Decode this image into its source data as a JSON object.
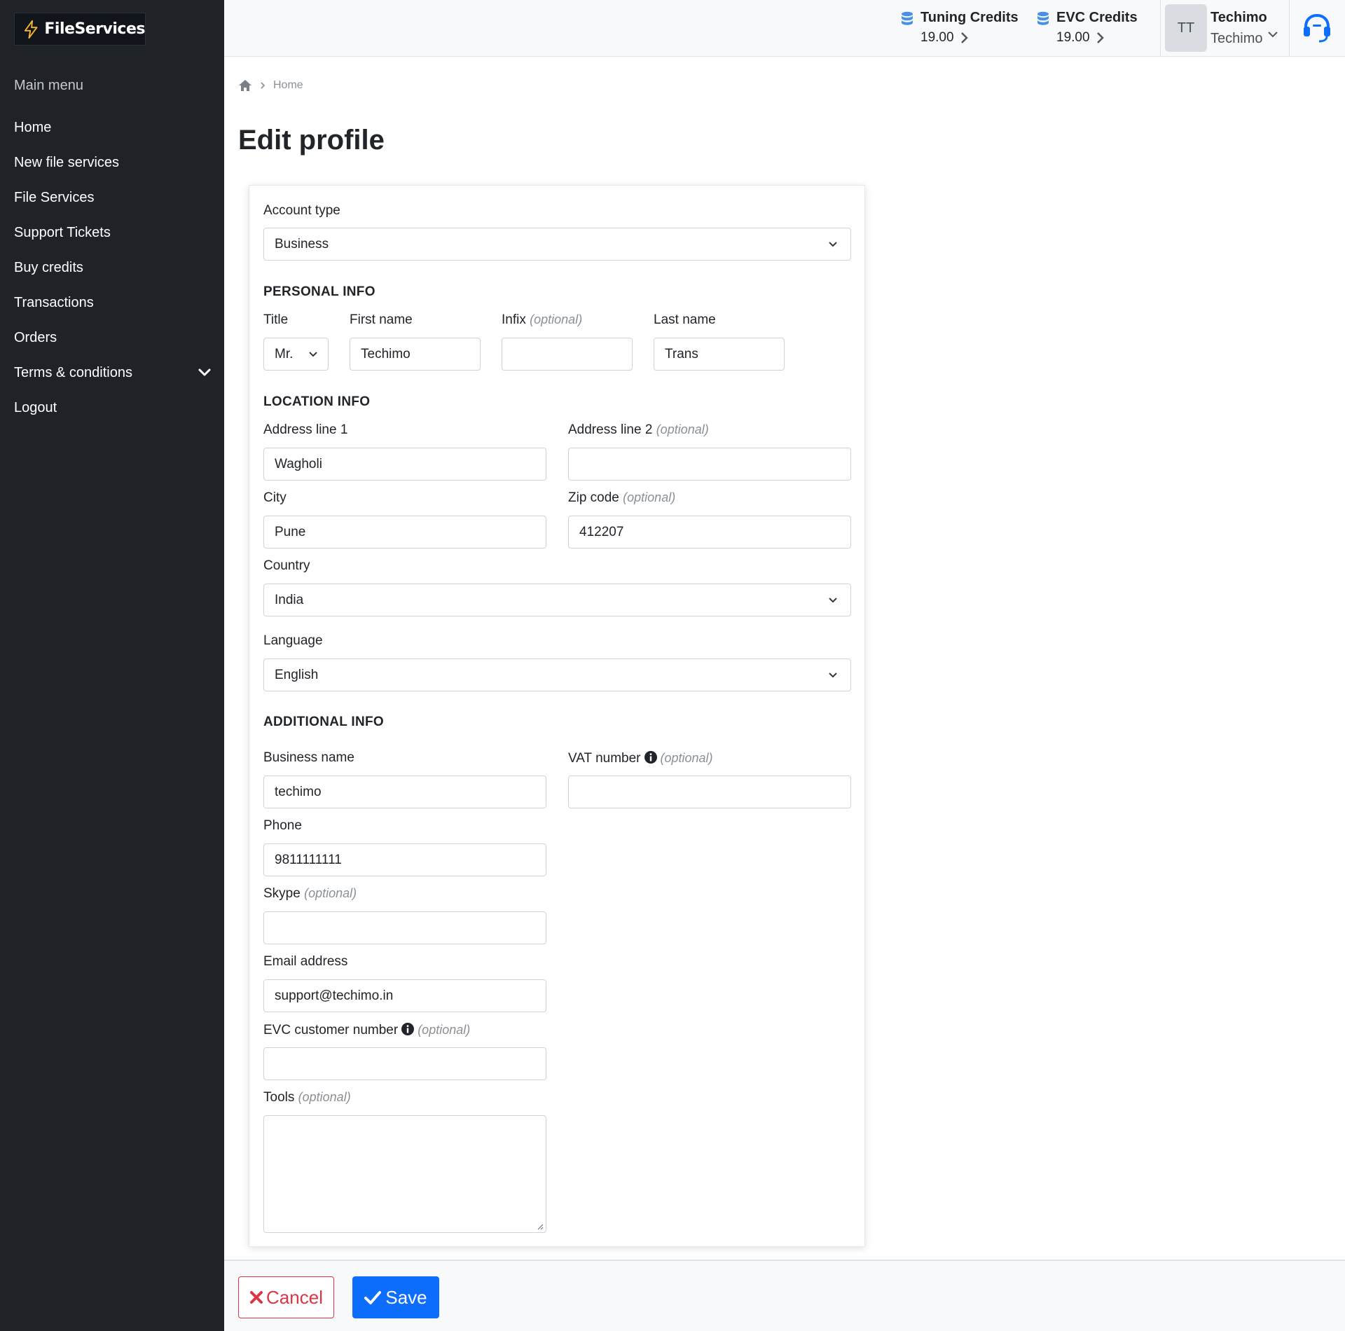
{
  "brand": {
    "name": "FileServices",
    "accent": "#f5b731"
  },
  "sidebar": {
    "title": "Main menu",
    "items": [
      {
        "label": "Home"
      },
      {
        "label": "New file services"
      },
      {
        "label": "File Services"
      },
      {
        "label": "Support Tickets"
      },
      {
        "label": "Buy credits"
      },
      {
        "label": "Transactions"
      },
      {
        "label": "Orders"
      },
      {
        "label": "Terms & conditions",
        "expandable": true
      },
      {
        "label": "Logout"
      }
    ]
  },
  "topbar": {
    "tuning": {
      "label": "Tuning Credits",
      "value": "19.00"
    },
    "evc": {
      "label": "EVC Credits",
      "value": "19.00"
    },
    "user": {
      "initials": "TT",
      "name": "Techimo",
      "sub": "Techimo"
    },
    "icons": [
      "database-icon",
      "chevron-right-icon",
      "chevron-down-icon",
      "headset-icon"
    ]
  },
  "breadcrumb": {
    "current": "Home"
  },
  "page": {
    "title": "Edit profile"
  },
  "form": {
    "account_type": {
      "label": "Account type",
      "value": "Business"
    },
    "personal_info": "PERSONAL INFO",
    "title": {
      "label": "Title",
      "value": "Mr."
    },
    "first_name": {
      "label": "First name",
      "value": "Techimo"
    },
    "infix": {
      "label": "Infix",
      "value": ""
    },
    "last_name": {
      "label": "Last name",
      "value": "Trans"
    },
    "location_info": "LOCATION INFO",
    "address1": {
      "label": "Address line 1",
      "value": "Wagholi"
    },
    "address2": {
      "label": "Address line 2",
      "value": ""
    },
    "city": {
      "label": "City",
      "value": "Pune"
    },
    "zip": {
      "label": "Zip code",
      "value": "412207"
    },
    "country": {
      "label": "Country",
      "value": "India"
    },
    "language": {
      "label": "Language",
      "value": "English"
    },
    "additional_info": "ADDITIONAL INFO",
    "business_name": {
      "label": "Business name",
      "value": "techimo"
    },
    "vat": {
      "label": "VAT number",
      "value": ""
    },
    "phone": {
      "label": "Phone",
      "value": "9811111111"
    },
    "skype": {
      "label": "Skype",
      "value": ""
    },
    "email": {
      "label": "Email address",
      "value": "support@techimo.in"
    },
    "evc_number": {
      "label": "EVC customer number",
      "value": ""
    },
    "tools": {
      "label": "Tools",
      "value": ""
    },
    "optional_text": "(optional)"
  },
  "actions": {
    "cancel": "Cancel",
    "save": "Save"
  },
  "colors": {
    "sidebar_bg": "#1f2328",
    "primary": "#0d6efd",
    "danger": "#dc3545"
  }
}
